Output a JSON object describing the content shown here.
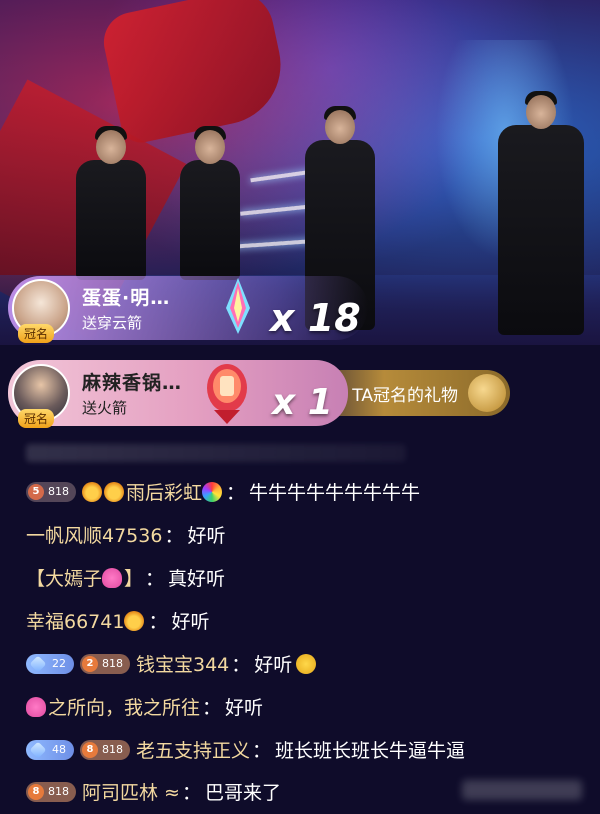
{
  "gifts": [
    {
      "name": "蛋蛋·明…",
      "action": "送穿云箭",
      "tag": "冠名",
      "count_prefix": "x",
      "count": "18",
      "icon": "arrow-gift-icon"
    },
    {
      "name": "麻辣香锅…",
      "action": "送火箭",
      "tag": "冠名",
      "count_prefix": "x",
      "count": "1",
      "icon": "rocket-gift-icon"
    }
  ],
  "ta_pill": {
    "label": "TA冠名的礼物"
  },
  "chat": [
    {
      "badges": [
        {
          "type": "level",
          "num": "5",
          "text": "818"
        }
      ],
      "emoji_before": [
        "lion",
        "lion"
      ],
      "user": "雨后彩虹",
      "emoji_after_user": [
        "rainbow"
      ],
      "sep": "：",
      "msg": "牛牛牛牛牛牛牛牛牛"
    },
    {
      "badges": [],
      "emoji_before": [],
      "user": "一帆风顺47536",
      "emoji_after_user": [],
      "sep": "：",
      "msg": "好听"
    },
    {
      "badges": [],
      "emoji_before": [],
      "user": "【大嫣子",
      "emoji_after_user": [
        "heart"
      ],
      "user_suffix": "】",
      "sep": "：",
      "msg": "真好听"
    },
    {
      "badges": [],
      "emoji_before": [],
      "user": "幸福66741",
      "emoji_after_user": [
        "lion"
      ],
      "sep": "：",
      "msg": "好听"
    },
    {
      "badges": [
        {
          "type": "fan",
          "num": "",
          "text": "22"
        },
        {
          "type": "level2",
          "num": "2",
          "text": "818"
        }
      ],
      "emoji_before": [],
      "user": "钱宝宝344",
      "emoji_after_user": [],
      "sep": "：",
      "msg": "好听",
      "emoji_after_msg": [
        "smile"
      ]
    },
    {
      "badges": [],
      "emoji_before": [
        "heart"
      ],
      "user": "之所向，我之所往",
      "emoji_after_user": [],
      "sep": "：",
      "msg": "好听"
    },
    {
      "badges": [
        {
          "type": "fan",
          "num": "",
          "text": "48"
        },
        {
          "type": "level2",
          "num": "8",
          "text": "818"
        }
      ],
      "emoji_before": [],
      "user": "老五支持正义",
      "emoji_after_user": [],
      "sep": "：",
      "msg": "班长班长班长牛逼牛逼"
    },
    {
      "badges": [
        {
          "type": "level2",
          "num": "8",
          "text": "818"
        }
      ],
      "emoji_before": [],
      "user": "阿司匹林 ≈",
      "emoji_after_user": [],
      "sep": "：",
      "msg": "巴哥来了"
    }
  ],
  "colors": {
    "username": "#f3d9a0",
    "background": "#0f0c2a"
  }
}
